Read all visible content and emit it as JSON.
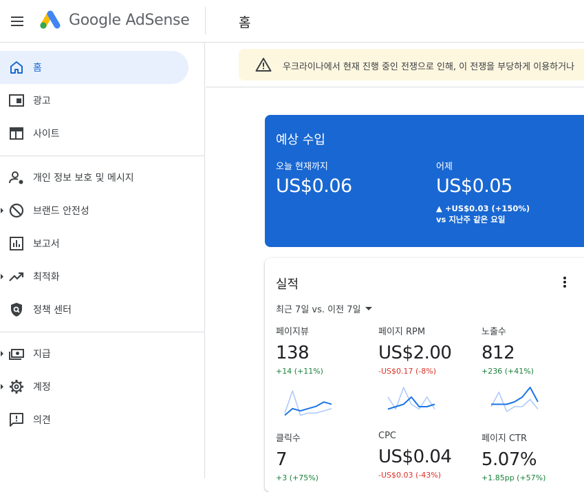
{
  "header": {
    "product_name": "Google AdSense",
    "page_title": "홈"
  },
  "sidebar": {
    "items": [
      {
        "label": "홈",
        "icon": "home-icon"
      },
      {
        "label": "광고",
        "icon": "ads-icon"
      },
      {
        "label": "사이트",
        "icon": "sites-icon"
      },
      {
        "label": "개인 정보 보호 및 메시지",
        "icon": "privacy-icon"
      },
      {
        "label": "브랜드 안전성",
        "icon": "block-icon"
      },
      {
        "label": "보고서",
        "icon": "reports-icon"
      },
      {
        "label": "최적화",
        "icon": "trending-icon"
      },
      {
        "label": "정책 센터",
        "icon": "policy-shield-icon"
      },
      {
        "label": "지급",
        "icon": "payments-icon"
      },
      {
        "label": "계정",
        "icon": "gear-icon"
      },
      {
        "label": "의견",
        "icon": "feedback-icon"
      }
    ]
  },
  "banner": {
    "text": "우크라이나에서 현재 진행 중인 전쟁으로 인해, 이 전쟁을 부당하게 이용하거나"
  },
  "earnings": {
    "title": "예상 수입",
    "today_label": "오늘 현재까지",
    "today_value": "US$0.06",
    "yesterday_label": "어제",
    "yesterday_value": "US$0.05",
    "yesterday_delta": "▲ +US$0.03 (+150%)",
    "yesterday_compare": "vs 지난주 같은 요일"
  },
  "performance": {
    "title": "실적",
    "range": "최근 7일 vs. 이전 7일",
    "metrics": [
      {
        "label": "페이지뷰",
        "value": "138",
        "delta": "+14 (+11%)",
        "trend": "positive",
        "current": [
          2,
          5,
          4,
          5,
          6,
          8,
          7
        ],
        "previous": [
          3,
          13,
          2,
          3,
          3,
          4,
          5
        ]
      },
      {
        "label": "페이지 RPM",
        "value": "US$2.00",
        "delta": "-US$0.17 (-8%)",
        "trend": "negative",
        "current": [
          3,
          4,
          5,
          8,
          4,
          4,
          5
        ],
        "previous": [
          8,
          3,
          12,
          5,
          3,
          8,
          3
        ]
      },
      {
        "label": "노출수",
        "value": "812",
        "delta": "+236 (+41%)",
        "trend": "positive",
        "current": [
          5,
          5,
          5,
          6,
          8,
          12,
          6
        ],
        "previous": [
          4,
          10,
          2,
          4,
          4,
          7,
          3
        ]
      },
      {
        "label": "클릭수",
        "value": "7",
        "delta": "+3 (+75%)",
        "trend": "positive"
      },
      {
        "label": "CPC",
        "value": "US$0.04",
        "delta": "-US$0.03 (-43%)",
        "trend": "negative"
      },
      {
        "label": "페이지 CTR",
        "value": "5.07%",
        "delta": "+1.85pp (+57%)",
        "trend": "positive"
      }
    ]
  },
  "colors": {
    "accent": "#1967d2",
    "spark_current": "#1a73e8",
    "spark_previous": "#aecbfa",
    "positive": "#188038",
    "negative": "#d93025"
  }
}
